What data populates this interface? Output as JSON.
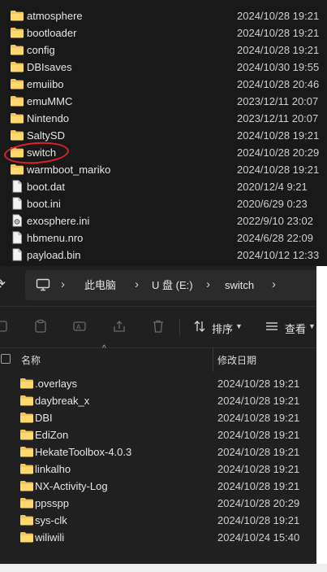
{
  "top_list": {
    "highlighted_item": "switch",
    "items": [
      {
        "name": "atmosphere",
        "date": "2024/10/28 19:21",
        "kind": "folder"
      },
      {
        "name": "bootloader",
        "date": "2024/10/28 19:21",
        "kind": "folder"
      },
      {
        "name": "config",
        "date": "2024/10/28 19:21",
        "kind": "folder"
      },
      {
        "name": "DBIsaves",
        "date": "2024/10/30 19:55",
        "kind": "folder"
      },
      {
        "name": "emuiibo",
        "date": "2024/10/28 20:46",
        "kind": "folder"
      },
      {
        "name": "emuMMC",
        "date": "2023/12/11 20:07",
        "kind": "folder"
      },
      {
        "name": "Nintendo",
        "date": "2023/12/11 20:07",
        "kind": "folder"
      },
      {
        "name": "SaltySD",
        "date": "2024/10/28 19:21",
        "kind": "folder"
      },
      {
        "name": "switch",
        "date": "2024/10/28 20:29",
        "kind": "folder"
      },
      {
        "name": "warmboot_mariko",
        "date": "2024/10/28 19:21",
        "kind": "folder"
      },
      {
        "name": "boot.dat",
        "date": "2020/12/4 9:21",
        "kind": "file"
      },
      {
        "name": "boot.ini",
        "date": "2020/6/29 0:23",
        "kind": "file"
      },
      {
        "name": "exosphere.ini",
        "date": "2022/9/10 23:02",
        "kind": "settings-file"
      },
      {
        "name": "hbmenu.nro",
        "date": "2024/6/28 22:09",
        "kind": "file"
      },
      {
        "name": "payload.bin",
        "date": "2024/10/12 12:33",
        "kind": "file"
      }
    ]
  },
  "address_bar": {
    "breadcrumbs": [
      "此电脑",
      "U 盘 (E:)",
      "switch"
    ]
  },
  "toolbar": {
    "sort_label": "排序",
    "view_label": "查看"
  },
  "columns": {
    "name": "名称",
    "date": "修改日期"
  },
  "bottom_list": {
    "items": [
      {
        "name": ".overlays",
        "date": "2024/10/28 19:21"
      },
      {
        "name": "daybreak_x",
        "date": "2024/10/28 19:21"
      },
      {
        "name": "DBI",
        "date": "2024/10/28 19:21"
      },
      {
        "name": "EdiZon",
        "date": "2024/10/28 19:21"
      },
      {
        "name": "HekateToolbox-4.0.3",
        "date": "2024/10/28 19:21"
      },
      {
        "name": "linkalho",
        "date": "2024/10/28 19:21"
      },
      {
        "name": "NX-Activity-Log",
        "date": "2024/10/28 19:21"
      },
      {
        "name": "ppsspp",
        "date": "2024/10/28 20:29"
      },
      {
        "name": "sys-clk",
        "date": "2024/10/28 19:21"
      },
      {
        "name": "wiliwili",
        "date": "2024/10/24 15:40"
      }
    ]
  },
  "colors": {
    "folder": "#f4c55a",
    "highlight_ring": "#e0202a",
    "background": "#191919"
  }
}
